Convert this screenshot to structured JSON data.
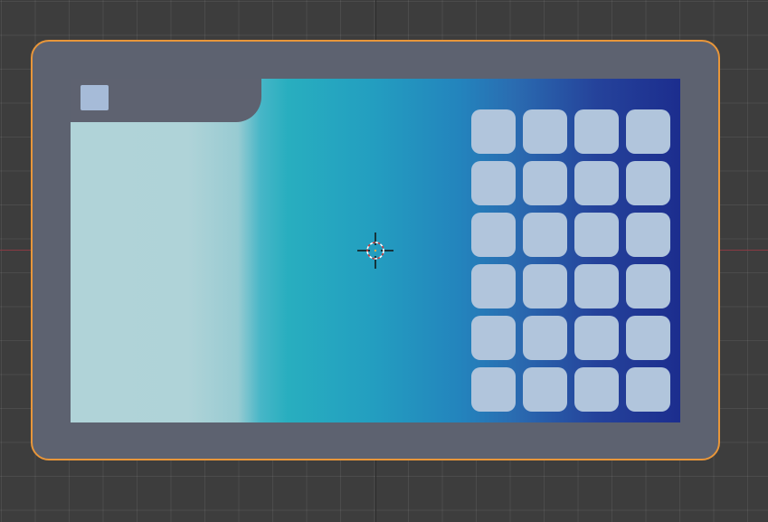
{
  "viewport": {
    "background_color": "#3d3d3d",
    "axis_x_color": "#8a3a43",
    "selection_outline_color": "#e8963a"
  },
  "device": {
    "frame_color": "#5d6270",
    "screen": {
      "gradient_colors": [
        "#b0d3d8",
        "#28aebf",
        "#2384bd",
        "#1c2d8e"
      ],
      "status_bar_color": "#5e6270",
      "status_icon": "square-app-icon",
      "app_grid": {
        "rows": 6,
        "columns": 4,
        "tile_color": "#b1c5dc"
      }
    }
  },
  "cursor": {
    "icon": "3d-cursor-icon"
  }
}
